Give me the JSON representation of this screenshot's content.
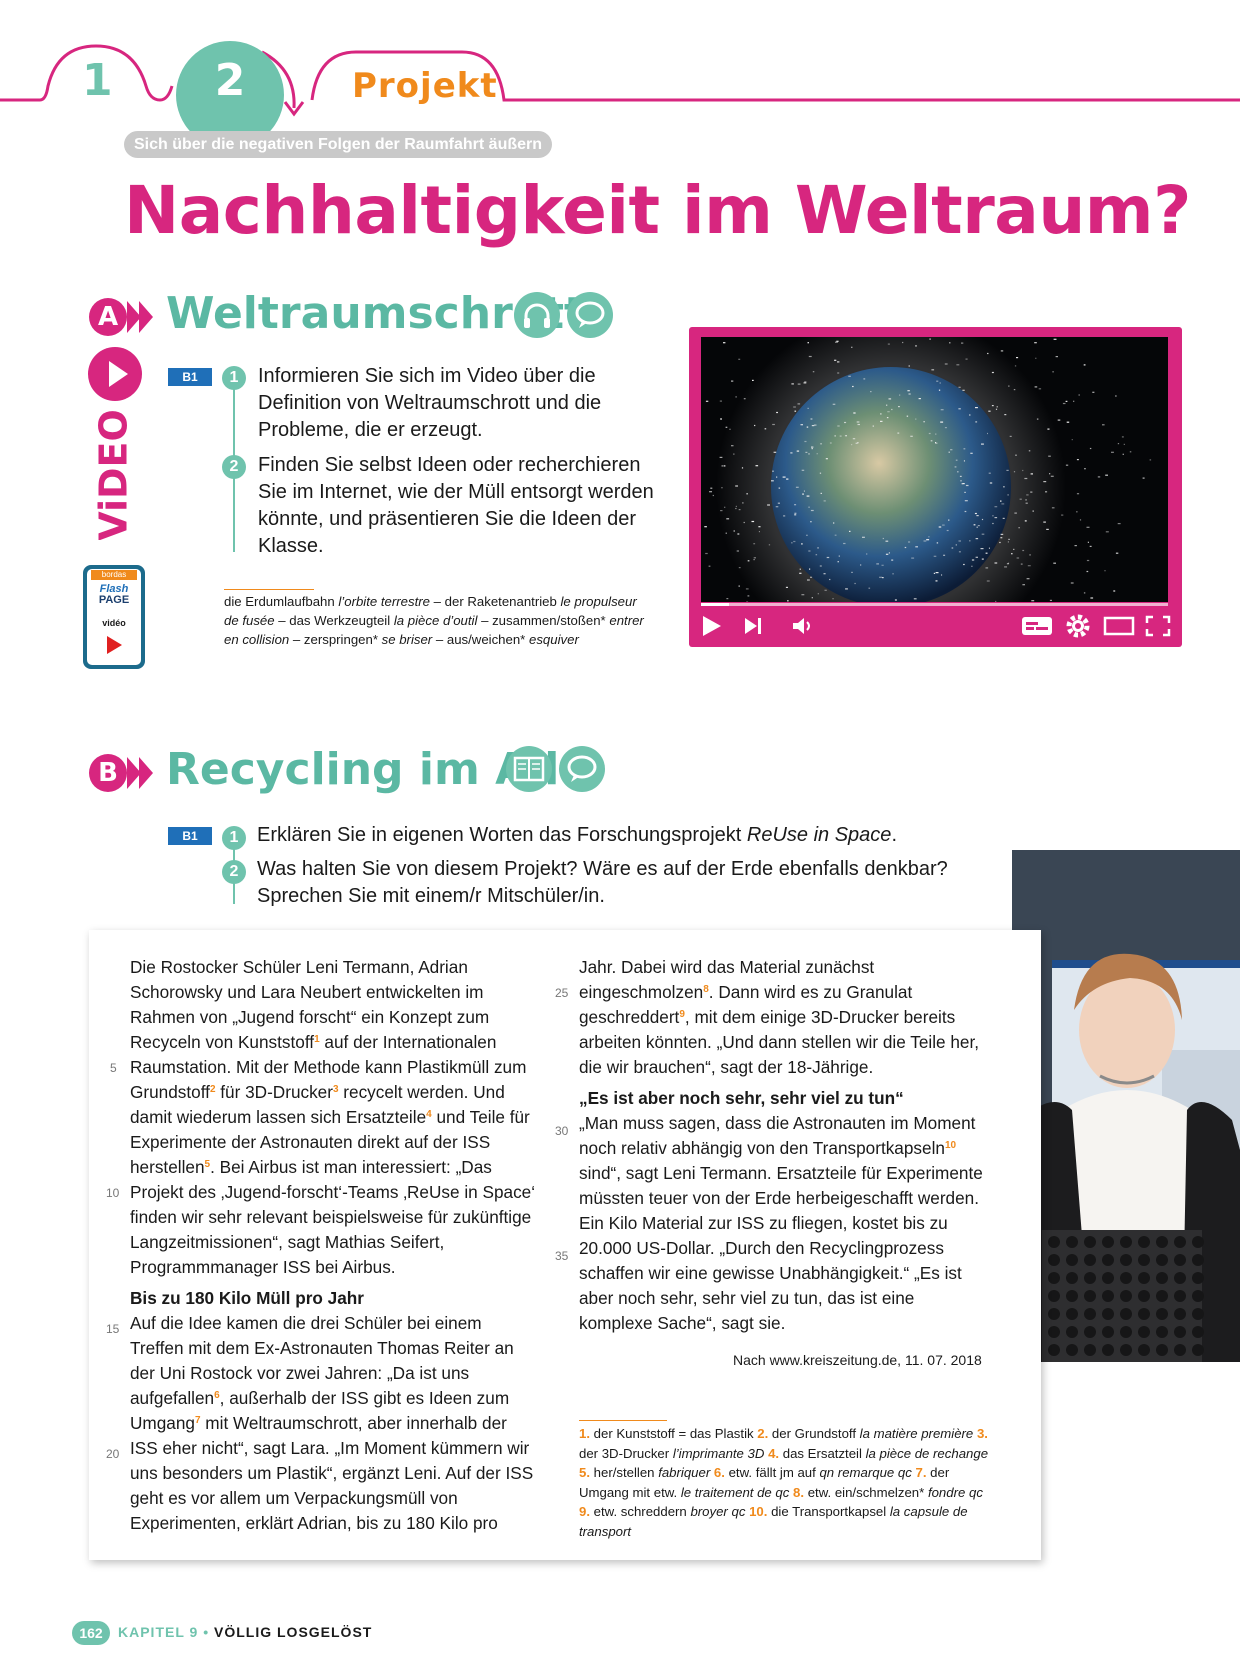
{
  "header": {
    "tab1": "1",
    "tab2": "2",
    "project_label": "Projekt",
    "subtitle": "Sich über die negativen Folgen der Raumfahrt äußern",
    "title": "Nachhaltigkeit im Weltraum?"
  },
  "sectionA": {
    "badge": "A",
    "title": "Weltraumschrott",
    "icons": [
      "headphones-icon",
      "speech-bubble-icon"
    ],
    "video_label": "ViDEO",
    "flashpage": {
      "brand": "bordas",
      "line1": "Flash",
      "line2": "PAGE",
      "line3": "vidéo"
    },
    "level": "B1",
    "tasks": [
      {
        "num": "1",
        "text": "Informieren Sie sich im Video über die Definition von Weltraumschrott und die Probleme, die er erzeugt."
      },
      {
        "num": "2",
        "text": "Finden Sie selbst Ideen oder recherchieren Sie im Internet, wie der Müll entsorgt werden könnte, und präsentieren Sie die Ideen der Klasse."
      }
    ],
    "vocab": {
      "p1": "die Erdumlaufbahn ",
      "i1": "l’orbite terrestre",
      "p2": " – der Raketenantrieb ",
      "i2": "le propulseur de fusée",
      "p3": " – das Werkzeugteil ",
      "i3": "la pièce d’outil",
      "p4": " – zusammen/stoßen* ",
      "i4": "entrer en collision",
      "p5": " – zerspringen* ",
      "i5": "se briser",
      "p6": " – aus/weichen* ",
      "i6": "esquiver"
    },
    "player": {
      "progress": 0.06,
      "controls": [
        "play-icon",
        "skip-next-icon",
        "volume-icon",
        "subtitles-icon",
        "settings-icon",
        "theater-icon",
        "fullscreen-icon"
      ]
    }
  },
  "sectionB": {
    "badge": "B",
    "title": "Recycling im All",
    "icons": [
      "book-icon",
      "speech-bubble-icon"
    ],
    "level": "B1",
    "task1_a": "Erklären Sie in eigenen Worten das Forschungsprojekt ",
    "task1_i": "ReUse in Space",
    "task1_b": ".",
    "task2": "Was halten Sie von diesem Projekt? Wäre es auf der Erde ebenfalls denkbar? Sprechen Sie mit einem/r Mitschüler/in."
  },
  "article": {
    "line_numbers": [
      "5",
      "10",
      "15",
      "20",
      "25",
      "30",
      "35"
    ],
    "left": {
      "p1a": "Die Rostocker Schüler Leni Termann, Adrian Schorowsky und Lara Neubert entwickelten im Rahmen von „Jugend forscht“ ein Konzept zum Recyceln von Kunststoff",
      "p1b": " auf der Internationalen Raumstation. Mit der Methode kann Plastikmüll zum Grundstoff",
      "p1c": " für 3D-Drucker",
      "p1d": " recycelt werden. Und damit wiederum lassen sich Ersatzteile",
      "p1e": " und Teile für Experimente der Astronauten direkt auf der ISS herstellen",
      "p1f": ". Bei Airbus ist man interessiert: „Das Projekt des ‚Jugend-forscht‘-Teams ‚ReUse in Space‘ finden wir sehr relevant beispielsweise für zukünftige Langzeitmissionen“, sagt Mathias Seifert, Programmmanager ISS bei Airbus.",
      "heading": "Bis zu 180 Kilo Müll pro Jahr",
      "p2a": "Auf die Idee kamen die drei Schüler bei einem Treffen mit dem Ex-Astronauten Thomas Reiter an der Uni Rostock vor zwei Jahren: „Da ist uns aufgefallen",
      "p2b": ", außerhalb der ISS gibt es Ideen zum Umgang",
      "p2c": " mit Weltraumschrott, aber innerhalb der ISS eher nicht“, sagt Lara. „Im Moment kümmern wir uns besonders um Plastik“, ergänzt Leni. Auf der ISS geht es vor allem um Verpackungsmüll von Experimenten, erklärt Adrian, bis zu 180 Kilo pro"
    },
    "right": {
      "p1a": "Jahr. Dabei wird das Material zunächst eingeschmolzen",
      "p1b": ". Dann wird es zu Granulat geschreddert",
      "p1c": ", mit dem einige 3D-Drucker bereits arbeiten könnten. „Und dann stellen wir die Teile her, die wir brauchen“, sagt der 18-Jährige.",
      "heading": "„Es ist aber noch sehr, sehr viel zu tun“",
      "p2a": "„Man muss sagen, dass die Astronauten im Moment noch relativ abhängig von den Transportkapseln",
      "p2b": " sind“, sagt Leni Termann. Ersatzteile für Experimente müssten teuer von der Erde herbeigeschafft werden. Ein Kilo Material zur ISS zu fliegen, kostet bis zu 20.000 US-Dollar. „Durch den Recyclingprozess schaffen wir eine gewisse Unabhängigkeit.“ „Es ist aber noch sehr, sehr viel zu tun, das ist eine komplexe Sache“, sagt sie."
    },
    "sup": [
      "1",
      "2",
      "3",
      "4",
      "5",
      "6",
      "7",
      "8",
      "9",
      "10"
    ],
    "source": "Nach www.kreiszeitung.de, 11. 07. 2018",
    "footnotes": [
      {
        "n": "1.",
        "de": " der Kunststoff = das Plastik ",
        "fr": ""
      },
      {
        "n": "2.",
        "de": " der Grundstoff ",
        "fr": "la matière première"
      },
      {
        "n": "3.",
        "de": " der 3D-Drucker ",
        "fr": "l’imprimante 3D"
      },
      {
        "n": "4.",
        "de": " das Ersatzteil ",
        "fr": "la pièce de rechange"
      },
      {
        "n": "5.",
        "de": " her/stellen ",
        "fr": "fabriquer"
      },
      {
        "n": "6.",
        "de": " etw. fällt jm auf ",
        "fr": "qn remarque qc"
      },
      {
        "n": "7.",
        "de": " der Umgang mit etw. ",
        "fr": "le traitement de qc"
      },
      {
        "n": "8.",
        "de": " etw. ein/schmelzen* ",
        "fr": "fondre qc"
      },
      {
        "n": "9.",
        "de": " etw. schreddern ",
        "fr": "broyer qc"
      },
      {
        "n": "10.",
        "de": " die Transportkapsel ",
        "fr": "la capsule de transport"
      }
    ]
  },
  "footer": {
    "page": "162",
    "chapter": "KAPITEL 9",
    "bullet": " • ",
    "title": "VÖLLIG LOSGELÖST"
  },
  "colors": {
    "magenta": "#d7267f",
    "teal": "#6fc3ad",
    "orange": "#f08a1c",
    "blue": "#1f6fb8"
  }
}
